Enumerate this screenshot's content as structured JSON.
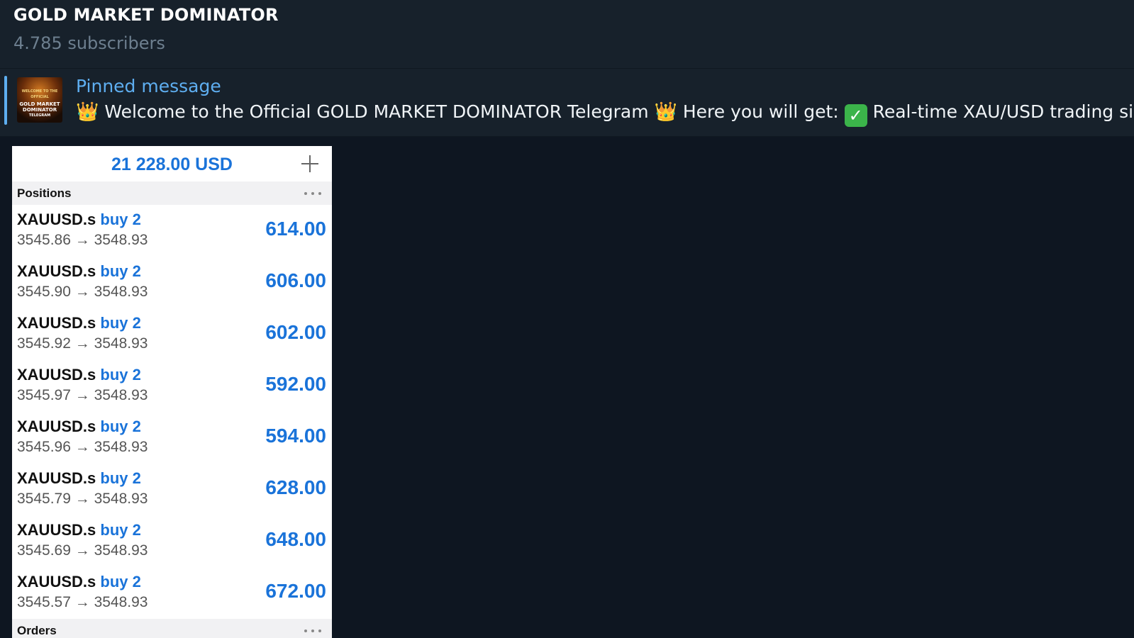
{
  "header": {
    "title": "GOLD MARKET DOMINATOR",
    "subscribers": "4.785 subscribers"
  },
  "pinned": {
    "label": "Pinned message",
    "thumbnail": {
      "line1": "WELCOME TO THE OFFICIAL",
      "line2": "GOLD MARKET DOMINATOR",
      "line3": "TELEGRAM"
    },
    "crown_emoji": "👑",
    "check_emoji": "✓",
    "text_part1": "Welcome to the Official GOLD MARKET DOMINATOR Telegram",
    "text_part2": "Here you will get:",
    "text_part3": "Real-time XAU/USD trading signals"
  },
  "trade_card": {
    "balance": "21 228.00 USD",
    "positions_label": "Positions",
    "orders_label": "Orders",
    "positions": [
      {
        "symbol": "XAUUSD.s",
        "side": "buy 2",
        "prices": "3545.86 → 3548.93",
        "profit": "614.00"
      },
      {
        "symbol": "XAUUSD.s",
        "side": "buy 2",
        "prices": "3545.90 → 3548.93",
        "profit": "606.00"
      },
      {
        "symbol": "XAUUSD.s",
        "side": "buy 2",
        "prices": "3545.92 → 3548.93",
        "profit": "602.00"
      },
      {
        "symbol": "XAUUSD.s",
        "side": "buy 2",
        "prices": "3545.97 → 3548.93",
        "profit": "592.00"
      },
      {
        "symbol": "XAUUSD.s",
        "side": "buy 2",
        "prices": "3545.96 → 3548.93",
        "profit": "594.00"
      },
      {
        "symbol": "XAUUSD.s",
        "side": "buy 2",
        "prices": "3545.79 → 3548.93",
        "profit": "628.00"
      },
      {
        "symbol": "XAUUSD.s",
        "side": "buy 2",
        "prices": "3545.69 → 3548.93",
        "profit": "648.00"
      },
      {
        "symbol": "XAUUSD.s",
        "side": "buy 2",
        "prices": "3545.57 → 3548.93",
        "profit": "672.00"
      }
    ]
  },
  "colors": {
    "background": "#0e1621",
    "header": "#17212b",
    "accent": "#5eaef0",
    "profit_blue": "#1a73d9"
  }
}
